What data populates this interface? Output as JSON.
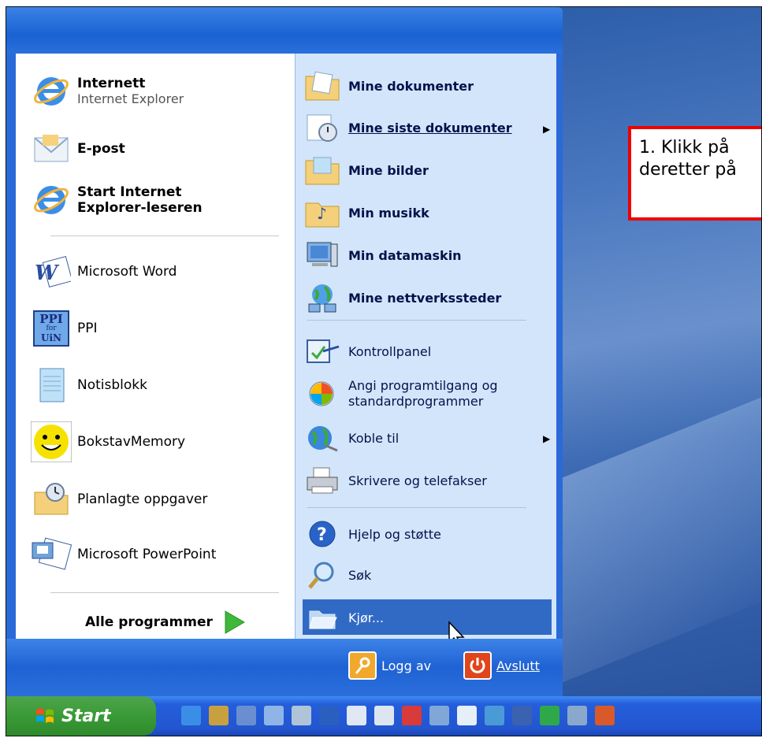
{
  "callout": {
    "line1": "1. Klikk på",
    "line2": "deretter på"
  },
  "pinned": [
    {
      "title": "Internett",
      "subtitle": "Internet Explorer"
    },
    {
      "title": "E-post",
      "subtitle": ""
    },
    {
      "title": "Start Internet",
      "subtitle": "Explorer-leseren"
    }
  ],
  "recent": [
    "Microsoft Word",
    "PPI",
    "Notisblokk",
    "BokstavMemory",
    "Planlagte oppgaver",
    "Microsoft PowerPoint"
  ],
  "all_programs": "Alle programmer",
  "right_bold": [
    "Mine dokumenter",
    "Mine siste dokumenter",
    "Mine bilder",
    "Min musikk",
    "Min datamaskin",
    "Mine nettverkssteder"
  ],
  "right_normal": {
    "control": "Kontrollpanel",
    "defaults_1": "Angi programtilgang og",
    "defaults_2": "standardprogrammer",
    "connect": "Koble til",
    "printers": "Skrivere og telefakser",
    "help": "Hjelp og støtte",
    "search": "Søk",
    "run": "Kjør..."
  },
  "bottom": {
    "logoff": "Logg av",
    "shutdown": "Avslutt"
  },
  "taskbar": {
    "start": "Start",
    "ppi_icon": "PPI",
    "ppi_icon_sub": "for",
    "ppi_icon_sub2": "UiN"
  },
  "colors": {
    "accent": "#316ac5",
    "callout_border": "#e00000",
    "start_green": "#3a9a37"
  }
}
